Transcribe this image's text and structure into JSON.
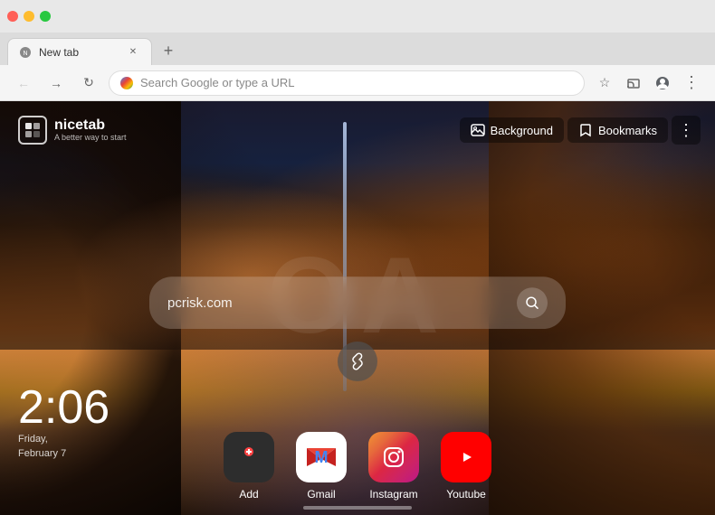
{
  "browser": {
    "tab_title": "New tab",
    "address_placeholder": "Search Google or type a URL",
    "address_value": ""
  },
  "toolbar": {
    "back_label": "←",
    "forward_label": "→",
    "reload_label": "↻",
    "bookmark_label": "☆",
    "menu_label": "⋮"
  },
  "page": {
    "logo_text": "nicetab",
    "logo_tagline": "A better way to start",
    "background_btn": "Background",
    "bookmarks_btn": "Bookmarks",
    "more_btn": "⋮",
    "search_placeholder": "pcrisk.com",
    "watermark": "OA",
    "clock_time": "2:06",
    "clock_day": "Friday,",
    "clock_date": "February 7"
  },
  "shortcuts": [
    {
      "id": "add",
      "label": "Add",
      "type": "add"
    },
    {
      "id": "gmail",
      "label": "Gmail",
      "type": "gmail"
    },
    {
      "id": "instagram",
      "label": "Instagram",
      "type": "instagram"
    },
    {
      "id": "youtube",
      "label": "Youtube",
      "type": "youtube"
    }
  ]
}
